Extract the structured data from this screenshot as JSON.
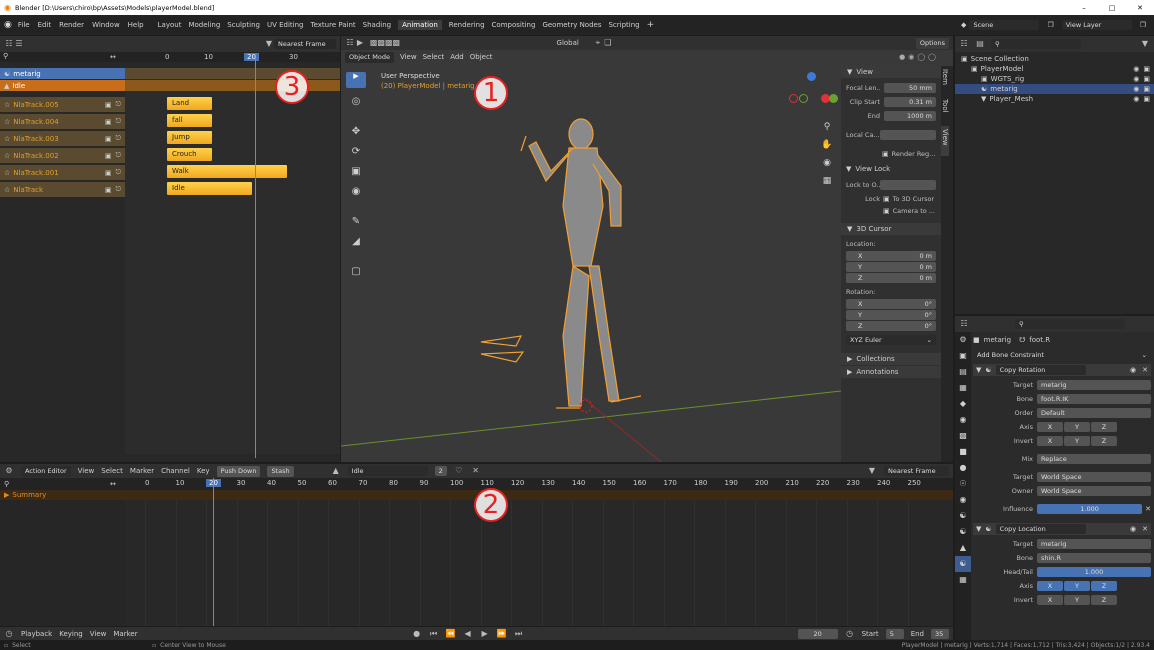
{
  "titlebar": {
    "title": "Blender [D:\\Users\\chiro\\bp\\Assets\\Models\\playerModel.blend]",
    "minimize": "–",
    "maximize": "□",
    "close": "✕"
  },
  "menus": [
    "File",
    "Edit",
    "Render",
    "Window",
    "Help"
  ],
  "workspaces": [
    "Layout",
    "Modeling",
    "Sculpting",
    "UV Editing",
    "Texture Paint",
    "Shading",
    "Animation",
    "Rendering",
    "Compositing",
    "Geometry Nodes",
    "Scripting"
  ],
  "active_workspace": "Animation",
  "scene": "Scene",
  "view_layer": "View Layer",
  "nla": {
    "filter": "Nearest Frame",
    "ticks": [
      "0",
      "10",
      "20",
      "30"
    ],
    "current_frame": "20",
    "tracks": [
      {
        "name": "metarig",
        "type": "object"
      },
      {
        "name": "Idle",
        "type": "action"
      },
      {
        "name": "NlaTrack.005",
        "strip": "Land"
      },
      {
        "name": "NlaTrack.004",
        "strip": "fall"
      },
      {
        "name": "NlaTrack.003",
        "strip": "Jump"
      },
      {
        "name": "NlaTrack.002",
        "strip": "Crouch"
      },
      {
        "name": "NlaTrack.001",
        "strip": "Walk"
      },
      {
        "name": "NlaTrack",
        "strip": "Idle"
      }
    ]
  },
  "viewport": {
    "mode": "Object Mode",
    "menus": [
      "View",
      "Select",
      "Add",
      "Object"
    ],
    "orientation": "Global",
    "options": "Options",
    "perspective": "User Perspective",
    "object_info": "(20) PlayerModel | metarig"
  },
  "view_panel": {
    "title": "View",
    "focal_label": "Focal Len..",
    "focal": "50 mm",
    "clip_start_label": "Clip Start",
    "clip_start": "0.31 m",
    "end_label": "End",
    "clip_end": "1000 m",
    "local_cam": "Local Ca...",
    "render_region": "Render Reg...",
    "view_lock": "View Lock",
    "lock_to": "Lock to O..",
    "lock": "Lock",
    "to_3d_cursor": "To 3D Cursor",
    "camera_to": "Camera to ...",
    "cursor_title": "3D Cursor",
    "location": "Location:",
    "x": "X",
    "y": "Y",
    "z": "Z",
    "loc_x": "0 m",
    "loc_y": "0 m",
    "loc_z": "0 m",
    "rotation": "Rotation:",
    "rot_x": "0°",
    "rot_y": "0°",
    "rot_z": "0°",
    "euler": "XYZ Euler",
    "collections": "Collections",
    "annotations": "Annotations",
    "tabs": [
      "Item",
      "Tool",
      "View"
    ]
  },
  "outliner": {
    "search": "",
    "items": [
      {
        "name": "Scene Collection",
        "indent": 0
      },
      {
        "name": "PlayerModel",
        "indent": 1
      },
      {
        "name": "WGTS_rig",
        "indent": 2
      },
      {
        "name": "metarig",
        "indent": 2,
        "selected": true
      },
      {
        "name": "Player_Mesh",
        "indent": 2
      }
    ]
  },
  "properties": {
    "object": "metarig",
    "bone": "foot.R",
    "add_constraint": "Add Bone Constraint",
    "c1": {
      "name": "Copy Rotation",
      "target_label": "Target",
      "target": "metarig",
      "bone_label": "Bone",
      "bone": "foot.R.IK",
      "order_label": "Order",
      "order": "Default",
      "axis_label": "Axis",
      "invert_label": "Invert",
      "mix_label": "Mix",
      "mix": "Replace",
      "target_space_label": "Target",
      "target_space": "World Space",
      "owner_label": "Owner",
      "owner_space": "World Space",
      "influence_label": "Influence",
      "influence": "1.000"
    },
    "c2": {
      "name": "Copy Location",
      "target_label": "Target",
      "target": "metarig",
      "bone_label": "Bone",
      "bone": "shin.R",
      "headtail_label": "Head/Tail",
      "headtail": "1.000",
      "axis_label": "Axis",
      "invert_label": "Invert"
    },
    "xyz": [
      "X",
      "Y",
      "Z"
    ]
  },
  "action_editor": {
    "editor": "Action Editor",
    "menus": [
      "View",
      "Select",
      "Marker",
      "Channel",
      "Key"
    ],
    "push_down": "Push Down",
    "stash": "Stash",
    "action": "Idle",
    "users": "2",
    "filter": "Nearest Frame",
    "summary": "Summary",
    "ticks": [
      "0",
      "10",
      "20",
      "30",
      "40",
      "50",
      "60",
      "70",
      "80",
      "90",
      "100",
      "110",
      "120",
      "130",
      "140",
      "150",
      "160",
      "170",
      "180",
      "190",
      "200",
      "210",
      "220",
      "230",
      "240",
      "250"
    ],
    "current_frame": "20"
  },
  "timeline": {
    "menus": [
      "Playback",
      "Keying",
      "View",
      "Marker"
    ],
    "frame": "20",
    "start_label": "Start",
    "start": "5",
    "end_label": "End",
    "end": "35"
  },
  "statusbar": {
    "left": "Select",
    "middle": "Center View to Mouse",
    "right": "PlayerModel | metarig | Verts:1,714 | Faces:1,712 | Tris:3,424 | Objects:1/2 | 2.93.4"
  },
  "callouts": [
    "1",
    "2",
    "3"
  ]
}
